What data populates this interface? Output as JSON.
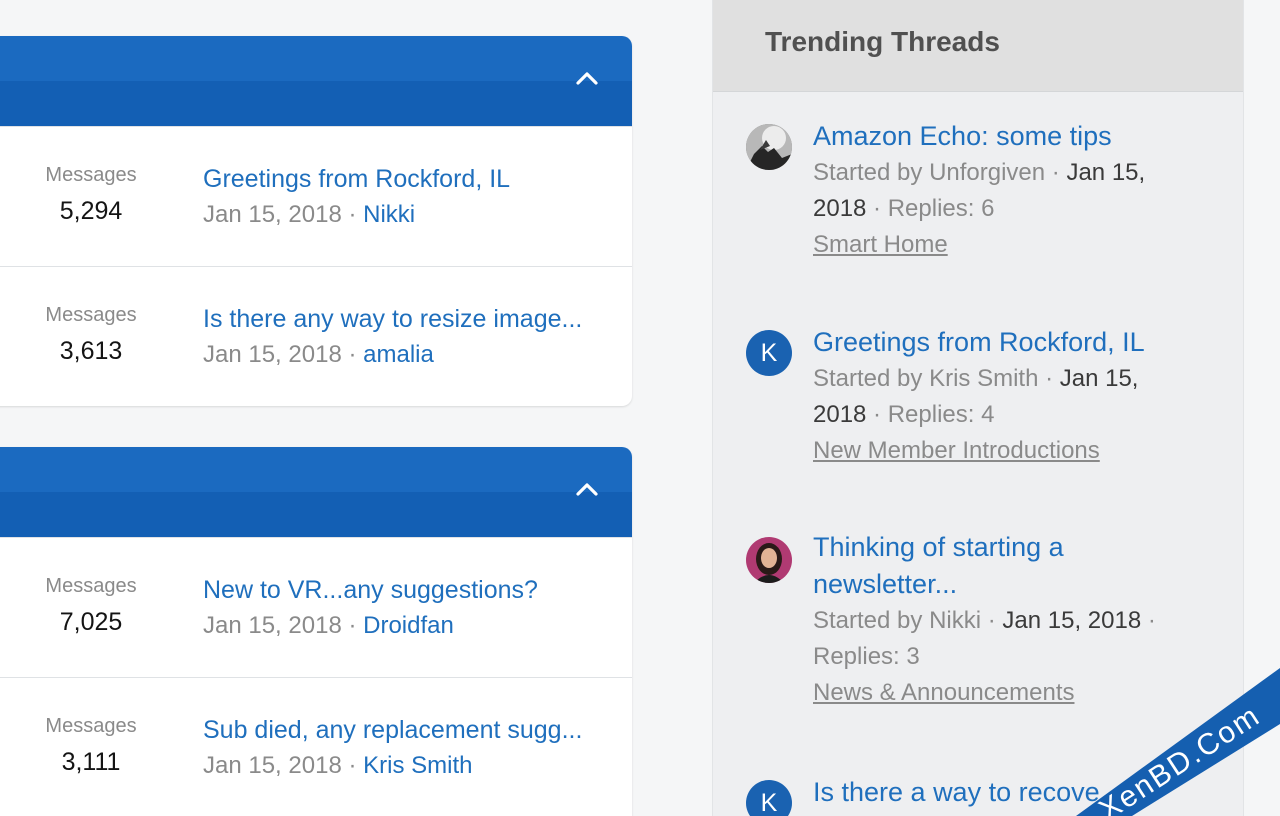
{
  "forum_blocks": [
    {
      "rows": [
        {
          "stat_label": "Messages",
          "stat_value": "5,294",
          "latest_title": "Greetings from Rockford, IL",
          "latest_date": "Jan 15, 2018",
          "latest_user": "Nikki"
        },
        {
          "stat_label": "Messages",
          "stat_value": "3,613",
          "latest_title": "Is there any way to resize image...",
          "latest_date": "Jan 15, 2018",
          "latest_user": "amalia"
        }
      ]
    },
    {
      "rows": [
        {
          "stat_label": "Messages",
          "stat_value": "7,025",
          "latest_title": "New to VR...any suggestions?",
          "latest_date": "Jan 15, 2018",
          "latest_user": "Droidfan"
        },
        {
          "stat_label": "Messages",
          "stat_value": "3,111",
          "latest_title": "Sub died, any replacement sugg...",
          "latest_date": "Jan 15, 2018",
          "latest_user": "Kris Smith"
        }
      ]
    }
  ],
  "sidebar": {
    "title": "Trending Threads",
    "threads": [
      {
        "title": "Amazon Echo: some tips",
        "meta_started": "Started by Unforgiven · ",
        "meta_date": "Jan 15,",
        "meta_line2_date": "2018",
        "meta_replies": " · Replies: 6",
        "forum": "Smart Home",
        "avatar": "photo-dark"
      },
      {
        "title": "Greetings from Rockford, IL",
        "meta_started": "Started by Kris Smith · ",
        "meta_date": "Jan 15,",
        "meta_line2_date": "2018",
        "meta_replies": " · Replies: 4",
        "forum": "New Member Introductions",
        "avatar": "K"
      },
      {
        "title_line1": "Thinking of starting a",
        "title_line2": "newsletter...",
        "meta_started": "Started by Nikki · ",
        "meta_date": "Jan 15, 2018",
        "meta_tail": " ·",
        "meta_replies": "Replies: 3",
        "forum": "News & Announcements",
        "avatar": "photo-woman"
      },
      {
        "title": "Is there a way to recove",
        "avatar": "K"
      }
    ]
  },
  "watermark": "XenBD.Com",
  "colors": {
    "accent": "#1b6ac0",
    "link": "#1f6fbd",
    "muted": "#8a8a8a",
    "watermark": "#155fb0"
  }
}
